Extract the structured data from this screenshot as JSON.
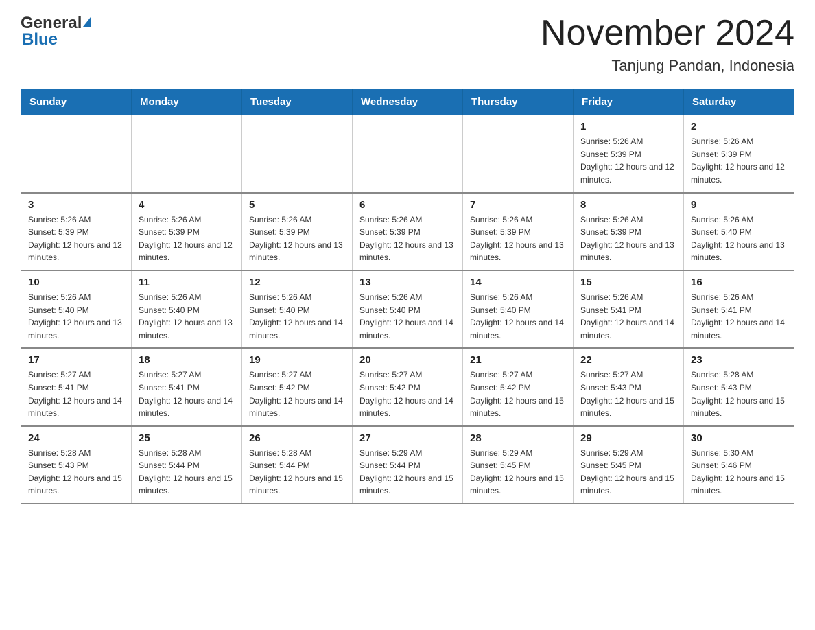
{
  "header": {
    "logo_general": "General",
    "logo_blue": "Blue",
    "month_title": "November 2024",
    "location": "Tanjung Pandan, Indonesia"
  },
  "days_of_week": [
    "Sunday",
    "Monday",
    "Tuesday",
    "Wednesday",
    "Thursday",
    "Friday",
    "Saturday"
  ],
  "weeks": [
    [
      {
        "day": "",
        "sunrise": "",
        "sunset": "",
        "daylight": "",
        "empty": true
      },
      {
        "day": "",
        "sunrise": "",
        "sunset": "",
        "daylight": "",
        "empty": true
      },
      {
        "day": "",
        "sunrise": "",
        "sunset": "",
        "daylight": "",
        "empty": true
      },
      {
        "day": "",
        "sunrise": "",
        "sunset": "",
        "daylight": "",
        "empty": true
      },
      {
        "day": "",
        "sunrise": "",
        "sunset": "",
        "daylight": "",
        "empty": true
      },
      {
        "day": "1",
        "sunrise": "Sunrise: 5:26 AM",
        "sunset": "Sunset: 5:39 PM",
        "daylight": "Daylight: 12 hours and 12 minutes.",
        "empty": false
      },
      {
        "day": "2",
        "sunrise": "Sunrise: 5:26 AM",
        "sunset": "Sunset: 5:39 PM",
        "daylight": "Daylight: 12 hours and 12 minutes.",
        "empty": false
      }
    ],
    [
      {
        "day": "3",
        "sunrise": "Sunrise: 5:26 AM",
        "sunset": "Sunset: 5:39 PM",
        "daylight": "Daylight: 12 hours and 12 minutes.",
        "empty": false
      },
      {
        "day": "4",
        "sunrise": "Sunrise: 5:26 AM",
        "sunset": "Sunset: 5:39 PM",
        "daylight": "Daylight: 12 hours and 12 minutes.",
        "empty": false
      },
      {
        "day": "5",
        "sunrise": "Sunrise: 5:26 AM",
        "sunset": "Sunset: 5:39 PM",
        "daylight": "Daylight: 12 hours and 13 minutes.",
        "empty": false
      },
      {
        "day": "6",
        "sunrise": "Sunrise: 5:26 AM",
        "sunset": "Sunset: 5:39 PM",
        "daylight": "Daylight: 12 hours and 13 minutes.",
        "empty": false
      },
      {
        "day": "7",
        "sunrise": "Sunrise: 5:26 AM",
        "sunset": "Sunset: 5:39 PM",
        "daylight": "Daylight: 12 hours and 13 minutes.",
        "empty": false
      },
      {
        "day": "8",
        "sunrise": "Sunrise: 5:26 AM",
        "sunset": "Sunset: 5:39 PM",
        "daylight": "Daylight: 12 hours and 13 minutes.",
        "empty": false
      },
      {
        "day": "9",
        "sunrise": "Sunrise: 5:26 AM",
        "sunset": "Sunset: 5:40 PM",
        "daylight": "Daylight: 12 hours and 13 minutes.",
        "empty": false
      }
    ],
    [
      {
        "day": "10",
        "sunrise": "Sunrise: 5:26 AM",
        "sunset": "Sunset: 5:40 PM",
        "daylight": "Daylight: 12 hours and 13 minutes.",
        "empty": false
      },
      {
        "day": "11",
        "sunrise": "Sunrise: 5:26 AM",
        "sunset": "Sunset: 5:40 PM",
        "daylight": "Daylight: 12 hours and 13 minutes.",
        "empty": false
      },
      {
        "day": "12",
        "sunrise": "Sunrise: 5:26 AM",
        "sunset": "Sunset: 5:40 PM",
        "daylight": "Daylight: 12 hours and 14 minutes.",
        "empty": false
      },
      {
        "day": "13",
        "sunrise": "Sunrise: 5:26 AM",
        "sunset": "Sunset: 5:40 PM",
        "daylight": "Daylight: 12 hours and 14 minutes.",
        "empty": false
      },
      {
        "day": "14",
        "sunrise": "Sunrise: 5:26 AM",
        "sunset": "Sunset: 5:40 PM",
        "daylight": "Daylight: 12 hours and 14 minutes.",
        "empty": false
      },
      {
        "day": "15",
        "sunrise": "Sunrise: 5:26 AM",
        "sunset": "Sunset: 5:41 PM",
        "daylight": "Daylight: 12 hours and 14 minutes.",
        "empty": false
      },
      {
        "day": "16",
        "sunrise": "Sunrise: 5:26 AM",
        "sunset": "Sunset: 5:41 PM",
        "daylight": "Daylight: 12 hours and 14 minutes.",
        "empty": false
      }
    ],
    [
      {
        "day": "17",
        "sunrise": "Sunrise: 5:27 AM",
        "sunset": "Sunset: 5:41 PM",
        "daylight": "Daylight: 12 hours and 14 minutes.",
        "empty": false
      },
      {
        "day": "18",
        "sunrise": "Sunrise: 5:27 AM",
        "sunset": "Sunset: 5:41 PM",
        "daylight": "Daylight: 12 hours and 14 minutes.",
        "empty": false
      },
      {
        "day": "19",
        "sunrise": "Sunrise: 5:27 AM",
        "sunset": "Sunset: 5:42 PM",
        "daylight": "Daylight: 12 hours and 14 minutes.",
        "empty": false
      },
      {
        "day": "20",
        "sunrise": "Sunrise: 5:27 AM",
        "sunset": "Sunset: 5:42 PM",
        "daylight": "Daylight: 12 hours and 14 minutes.",
        "empty": false
      },
      {
        "day": "21",
        "sunrise": "Sunrise: 5:27 AM",
        "sunset": "Sunset: 5:42 PM",
        "daylight": "Daylight: 12 hours and 15 minutes.",
        "empty": false
      },
      {
        "day": "22",
        "sunrise": "Sunrise: 5:27 AM",
        "sunset": "Sunset: 5:43 PM",
        "daylight": "Daylight: 12 hours and 15 minutes.",
        "empty": false
      },
      {
        "day": "23",
        "sunrise": "Sunrise: 5:28 AM",
        "sunset": "Sunset: 5:43 PM",
        "daylight": "Daylight: 12 hours and 15 minutes.",
        "empty": false
      }
    ],
    [
      {
        "day": "24",
        "sunrise": "Sunrise: 5:28 AM",
        "sunset": "Sunset: 5:43 PM",
        "daylight": "Daylight: 12 hours and 15 minutes.",
        "empty": false
      },
      {
        "day": "25",
        "sunrise": "Sunrise: 5:28 AM",
        "sunset": "Sunset: 5:44 PM",
        "daylight": "Daylight: 12 hours and 15 minutes.",
        "empty": false
      },
      {
        "day": "26",
        "sunrise": "Sunrise: 5:28 AM",
        "sunset": "Sunset: 5:44 PM",
        "daylight": "Daylight: 12 hours and 15 minutes.",
        "empty": false
      },
      {
        "day": "27",
        "sunrise": "Sunrise: 5:29 AM",
        "sunset": "Sunset: 5:44 PM",
        "daylight": "Daylight: 12 hours and 15 minutes.",
        "empty": false
      },
      {
        "day": "28",
        "sunrise": "Sunrise: 5:29 AM",
        "sunset": "Sunset: 5:45 PM",
        "daylight": "Daylight: 12 hours and 15 minutes.",
        "empty": false
      },
      {
        "day": "29",
        "sunrise": "Sunrise: 5:29 AM",
        "sunset": "Sunset: 5:45 PM",
        "daylight": "Daylight: 12 hours and 15 minutes.",
        "empty": false
      },
      {
        "day": "30",
        "sunrise": "Sunrise: 5:30 AM",
        "sunset": "Sunset: 5:46 PM",
        "daylight": "Daylight: 12 hours and 15 minutes.",
        "empty": false
      }
    ]
  ]
}
